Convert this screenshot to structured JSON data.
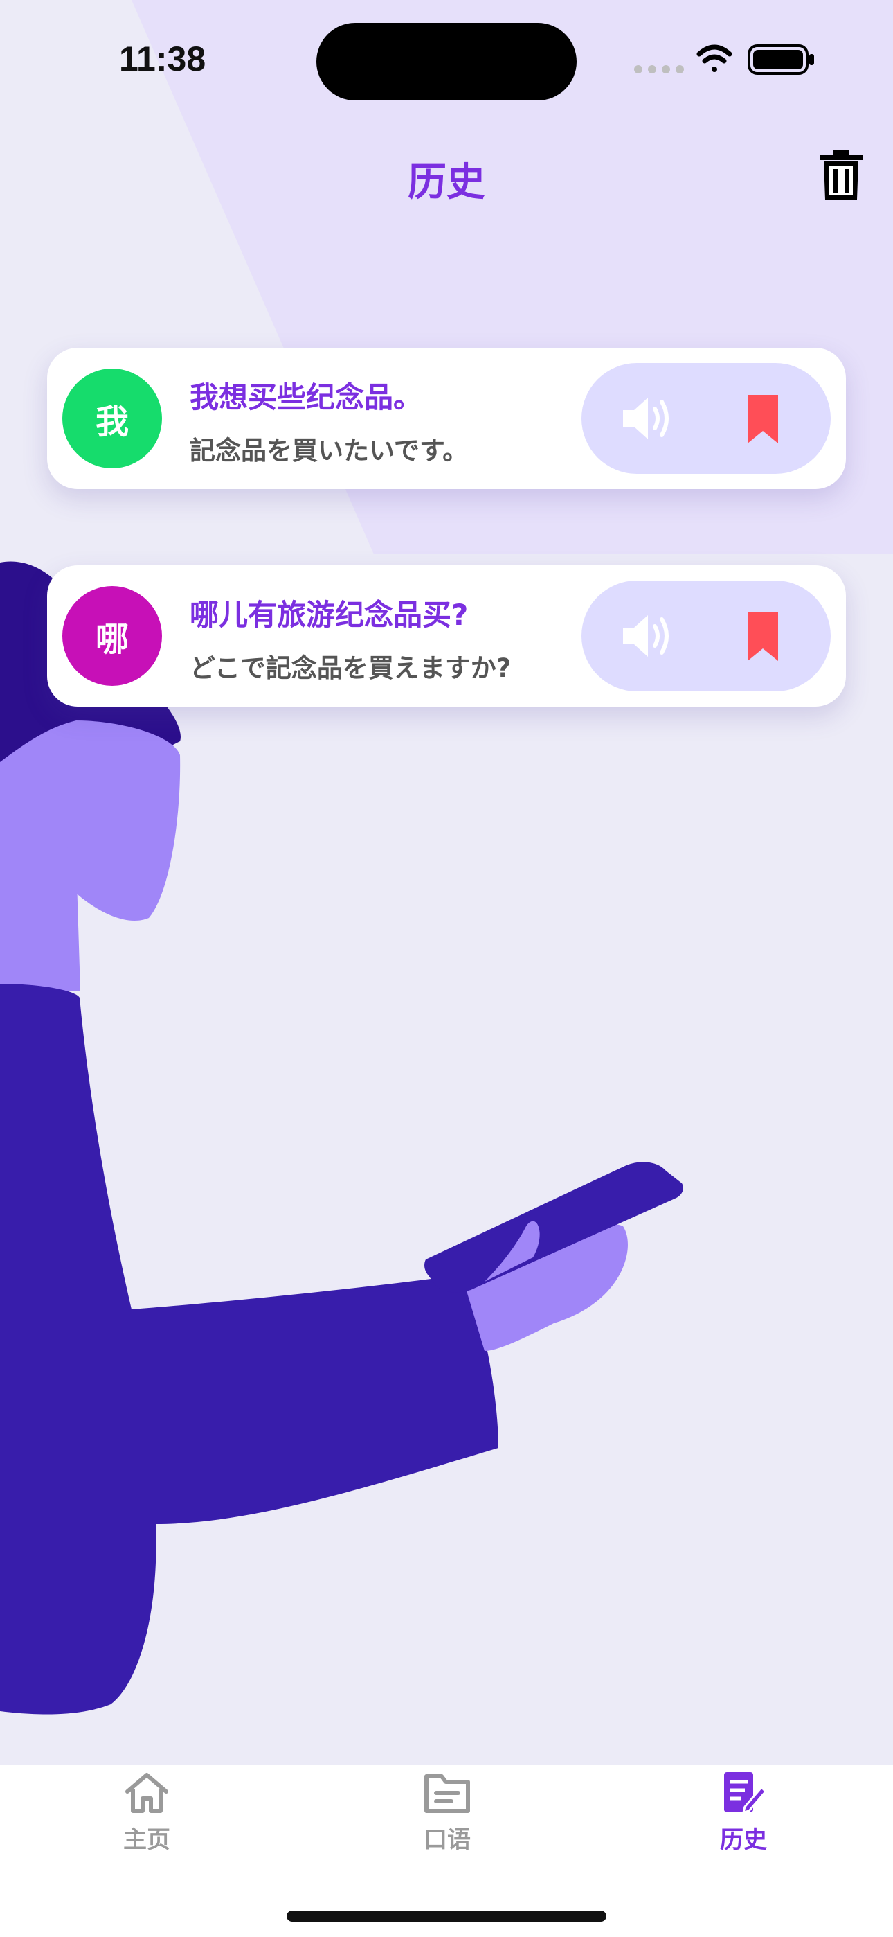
{
  "status_bar": {
    "time": "11:38"
  },
  "header": {
    "title": "历史"
  },
  "history": [
    {
      "avatar_char": "我",
      "avatar_color": "#16DC6C",
      "phrase": "我想买些纪念品。",
      "translation": "記念品を買いたいです。"
    },
    {
      "avatar_char": "哪",
      "avatar_color": "#C710B7",
      "phrase": "哪儿有旅游纪念品买?",
      "translation": "どこで記念品を買えますか?"
    }
  ],
  "tabbar": {
    "tabs": [
      {
        "label": "主页",
        "icon": "home-icon"
      },
      {
        "label": "口语",
        "icon": "folder-icon"
      },
      {
        "label": "历史",
        "icon": "edit-note-icon"
      }
    ],
    "active_tab": "历史"
  },
  "colors": {
    "accent": "#7B2FE0",
    "bookmark": "#FF4E57",
    "action_pill": "#DEDCFF",
    "background": "#ECEBF7"
  }
}
